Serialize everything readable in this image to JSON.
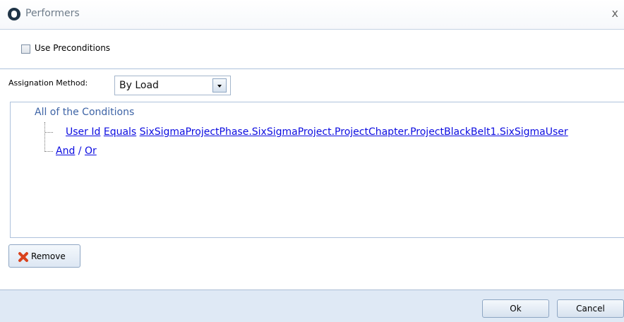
{
  "window": {
    "title": "Performers",
    "close_label": "x"
  },
  "preconditions": {
    "checkbox_label": "Use Preconditions",
    "checked": false
  },
  "assignation": {
    "label": "Assignation Method:",
    "selected": "By Load"
  },
  "conditions": {
    "root_label": "All of the Conditions",
    "rule": {
      "field": "User Id",
      "operator": "Equals",
      "value": "SixSigmaProjectPhase.SixSigmaProject.ProjectChapter.ProjectBlackBelt1.SixSigmaUser"
    },
    "add_and": "And",
    "separator": "/",
    "add_or": "Or"
  },
  "actions": {
    "remove_label": "Remove",
    "remove_icon": "red-x-icon"
  },
  "footer": {
    "ok_label": "Ok",
    "cancel_label": "Cancel"
  },
  "colors": {
    "link": "#0c0ce0",
    "root": "#3e64a6",
    "footer_bg": "#dfe9f5"
  }
}
